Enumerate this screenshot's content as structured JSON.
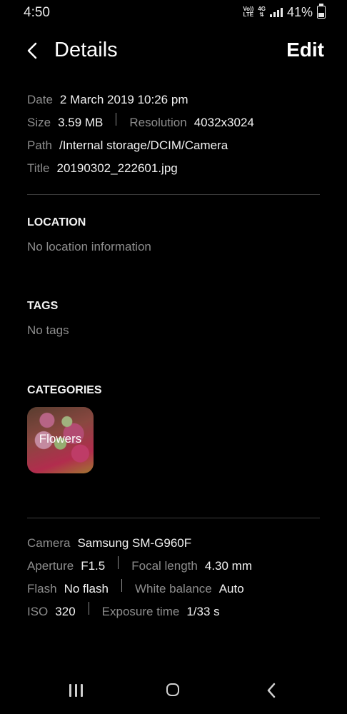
{
  "status_bar": {
    "time": "4:50",
    "volte_top": "Vo))",
    "volte_bottom": "LTE",
    "network": "4G",
    "battery_percent": "41%"
  },
  "header": {
    "title": "Details",
    "edit_label": "Edit"
  },
  "file_info": {
    "date_label": "Date",
    "date_value": "2 March 2019 10:26 pm",
    "size_label": "Size",
    "size_value": "3.59 MB",
    "resolution_label": "Resolution",
    "resolution_value": "4032x3024",
    "path_label": "Path",
    "path_value": "/Internal storage/DCIM/Camera",
    "title_label": "Title",
    "title_value": "20190302_222601.jpg"
  },
  "location": {
    "heading": "LOCATION",
    "empty_text": "No location information"
  },
  "tags": {
    "heading": "TAGS",
    "empty_text": "No tags"
  },
  "categories": {
    "heading": "CATEGORIES",
    "items": [
      {
        "label": "Flowers"
      }
    ]
  },
  "camera_info": {
    "camera_label": "Camera",
    "camera_value": "Samsung SM-G960F",
    "aperture_label": "Aperture",
    "aperture_value": "F1.5",
    "focal_label": "Focal length",
    "focal_value": "4.30 mm",
    "flash_label": "Flash",
    "flash_value": "No flash",
    "wb_label": "White balance",
    "wb_value": "Auto",
    "iso_label": "ISO",
    "iso_value": "320",
    "exposure_label": "Exposure time",
    "exposure_value": "1/33 s"
  },
  "nav_bar": {
    "icons": [
      "recents-icon",
      "home-icon",
      "back-icon"
    ]
  }
}
